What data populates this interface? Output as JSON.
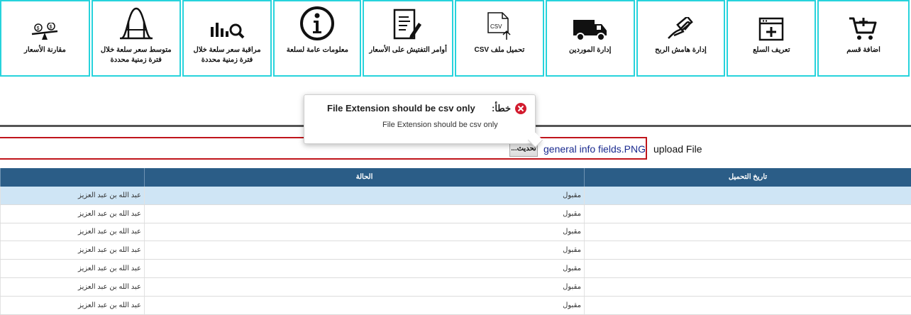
{
  "tiles": [
    {
      "label": "اضافة قسم",
      "icon": "cart-add-icon",
      "width": 130
    },
    {
      "label": "تعريف السلع",
      "icon": "window-add-icon",
      "width": 126
    },
    {
      "label": "إدارة هامش الربح",
      "icon": "hand-money-icon",
      "width": 126
    },
    {
      "label": "إدارة الموردين",
      "icon": "truck-icon",
      "width": 126
    },
    {
      "label": "تحميل ملف CSV",
      "icon": "csv-upload-icon",
      "width": 126
    },
    {
      "label": "أوامر التفتيش على الأسعار",
      "icon": "document-edit-icon",
      "width": 128
    },
    {
      "label": "معلومات عامة لسلعة",
      "icon": "info-icon",
      "width": 124
    },
    {
      "label": "مراقبة سعر سلعة خلال فترة زمنية محددة",
      "icon": "bar-chart-search-icon",
      "width": 127
    },
    {
      "label": "متوسط سعر سلعة خلال فترة زمنية محددة",
      "icon": "bell-curve-icon",
      "width": 126
    },
    {
      "label": "مقارنة الأسعار",
      "icon": "scale-compare-icon",
      "width": 127
    }
  ],
  "upload": {
    "label": "upload File",
    "file_name": "general info fields.PNG",
    "browse_label": "تحديث..."
  },
  "error": {
    "label": "خطأ:",
    "title": "File Extension should be csv only",
    "message": "File Extension should be csv only",
    "icon": "error-circle-icon",
    "color": "#d21b2e"
  },
  "table": {
    "headers": {
      "upload_date": "تاريخ التحميل",
      "status": "الحالة",
      "user": ""
    },
    "header_color": "#2b5d87",
    "rows": [
      {
        "date": "",
        "status": "مقبول",
        "user": "عبد الله بن عبد العزيز"
      },
      {
        "date": "",
        "status": "مقبول",
        "user": "عبد الله بن عبد العزيز"
      },
      {
        "date": "",
        "status": "مقبول",
        "user": "عبد الله بن عبد العزيز"
      },
      {
        "date": "",
        "status": "مقبول",
        "user": "عبد الله بن عبد العزيز"
      },
      {
        "date": "",
        "status": "مقبول",
        "user": "عبد الله بن عبد العزيز"
      },
      {
        "date": "",
        "status": "مقبول",
        "user": "عبد الله بن عبد العزيز"
      },
      {
        "date": "",
        "status": "مقبول",
        "user": "عبد الله بن عبد العزيز"
      }
    ]
  },
  "accent_color": "#27d3dc"
}
